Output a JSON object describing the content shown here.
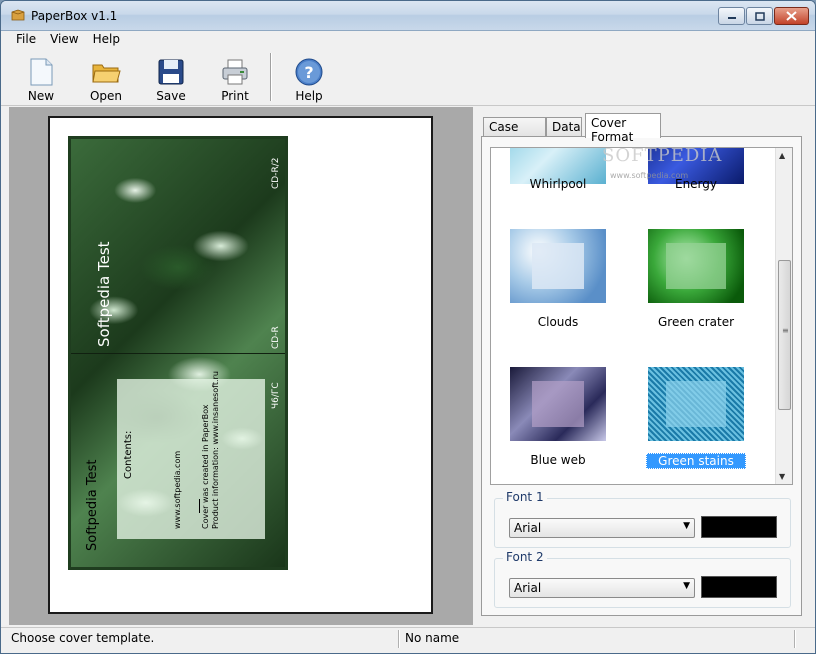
{
  "window": {
    "title": "PaperBox v1.1"
  },
  "menu": {
    "items": [
      "File",
      "View",
      "Help"
    ]
  },
  "toolbar": {
    "buttons": [
      {
        "label": "New",
        "icon": "new-document-icon"
      },
      {
        "label": "Open",
        "icon": "open-folder-icon"
      },
      {
        "label": "Save",
        "icon": "floppy-disk-icon"
      },
      {
        "label": "Print",
        "icon": "printer-icon"
      },
      {
        "label": "Help",
        "icon": "help-question-icon"
      }
    ]
  },
  "preview": {
    "cover_title": "Softpedia Test",
    "side_a": "CD-R/2",
    "side_b": "CD-R",
    "side_c": "Ч6/ГС",
    "back_title": "Softpedia Test",
    "contents_label": "Contents:",
    "url": "www.softpedia.com",
    "made_line": "Cover was created in PaperBox",
    "info_line": "Product information: www.insanesoft.ru"
  },
  "tabs": {
    "items": [
      "Case Type",
      "Data",
      "Cover Format"
    ],
    "active": "Cover Format"
  },
  "watermark": {
    "text": "SOFTPEDIA",
    "url": "www.softpedia.com"
  },
  "templates": {
    "items": [
      {
        "name": "Whirlpool"
      },
      {
        "name": "Energy"
      },
      {
        "name": "Clouds"
      },
      {
        "name": "Green crater"
      },
      {
        "name": "Blue web"
      },
      {
        "name": "Green stains",
        "selected": true
      }
    ]
  },
  "fonts": {
    "font1": {
      "label": "Font 1",
      "value": "Arial",
      "color": "#000000"
    },
    "font2": {
      "label": "Font 2",
      "value": "Arial",
      "color": "#000000"
    }
  },
  "status": {
    "left": "Choose cover template.",
    "right": "No name"
  }
}
